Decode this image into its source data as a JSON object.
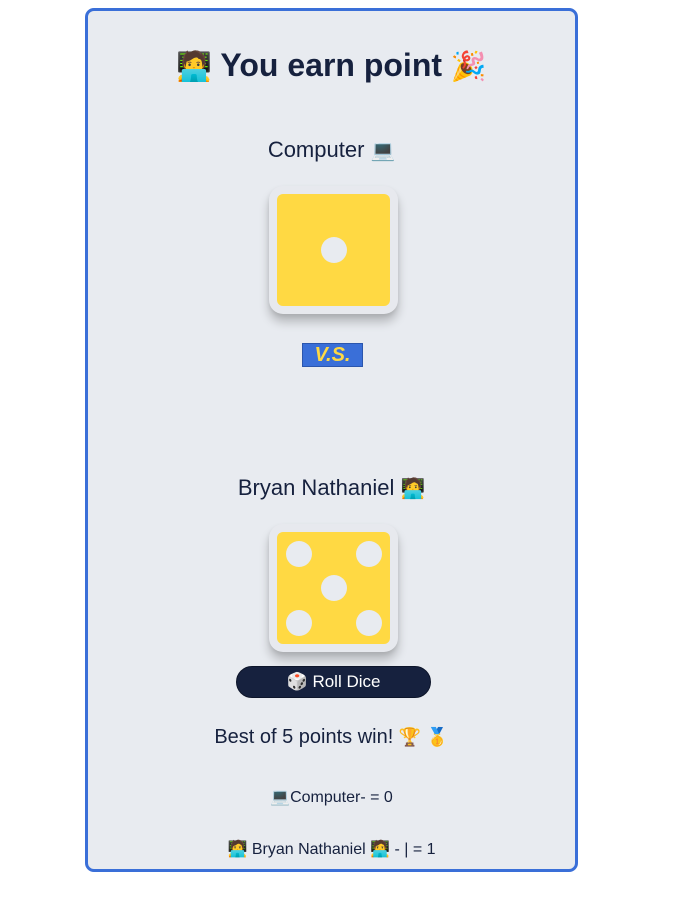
{
  "header": {
    "title": "You earn point",
    "title_left_emoji": "🧑‍💻",
    "title_right_emoji": "🎉"
  },
  "computer": {
    "name": "Computer",
    "emoji": "💻",
    "die_value": 1
  },
  "versus_label": "V.S.",
  "player": {
    "name": "Bryan Nathaniel",
    "emoji": "🧑‍💻",
    "die_value": 5
  },
  "roll_button": {
    "icon": "🎲",
    "label": "Roll Dice"
  },
  "rules": {
    "text": "Best of 5 points win!",
    "emoji": "🏆 🥇"
  },
  "scoreboard": {
    "computer_line": "💻Computer- = 0",
    "player_line": "🧑‍💻 Bryan Nathaniel 🧑‍💻 - | = 1"
  },
  "colors": {
    "accent_blue": "#3a6fd8",
    "dark_navy": "#16213e",
    "die_yellow": "#ffd943",
    "card_background": "#e8ebf0"
  }
}
